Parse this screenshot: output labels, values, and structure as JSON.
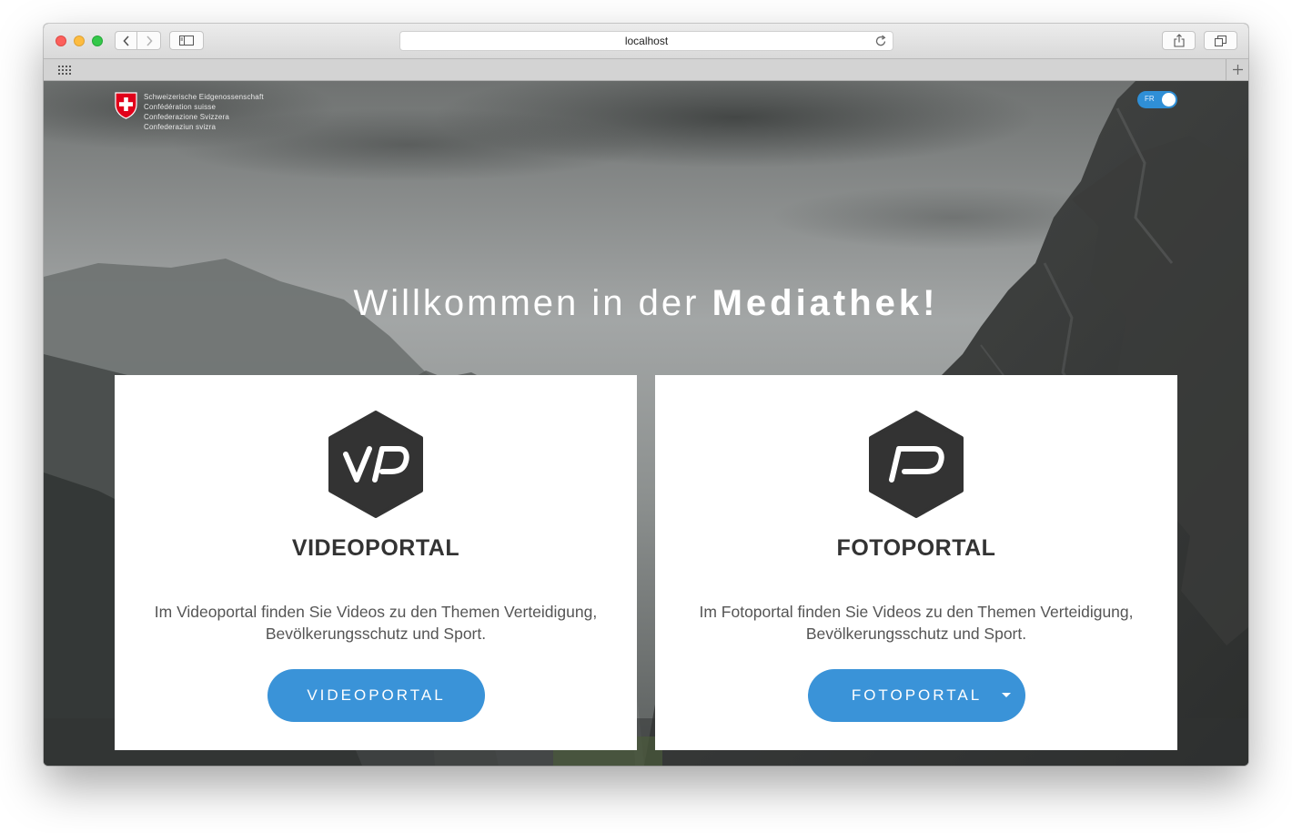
{
  "browser": {
    "url": "localhost",
    "icons": {
      "back": "chevron-left-icon",
      "forward": "chevron-right-icon",
      "sidebar": "sidebar-icon",
      "reload": "reload-icon",
      "share": "share-icon",
      "tabs": "tabs-icon",
      "top_sites": "grid-icon",
      "new_tab": "plus-icon"
    }
  },
  "header": {
    "logo_lines": [
      "Schweizerische Eidgenossenschaft",
      "Confédération suisse",
      "Confederazione Svizzera",
      "Confederaziun svizra"
    ],
    "language_toggle": {
      "label": "FR",
      "on": true
    }
  },
  "hero": {
    "headline_prefix": "Willkommen in der ",
    "headline_bold": "Mediathek!"
  },
  "cards": [
    {
      "icon": "videoportal-logo-icon",
      "title": "VIDEOPORTAL",
      "description": "Im Videoportal finden Sie Videos zu den Themen Verteidigung, Bevölkerungsschutz und Sport.",
      "button": "VIDEOPORTAL"
    },
    {
      "icon": "fotoportal-logo-icon",
      "title": "FOTOPORTAL",
      "description": "Im Fotoportal finden Sie Videos zu den Themen Verteidigung, Bevölkerungsschutz und Sport.",
      "button": "FOTOPORTAL",
      "has_dropdown": true
    }
  ],
  "colors": {
    "accent": "#3a93d8",
    "toggle": "#2f8fd6",
    "card_title": "#333333",
    "hex_icon": "#333333",
    "swiss_red": "#e1001a"
  }
}
